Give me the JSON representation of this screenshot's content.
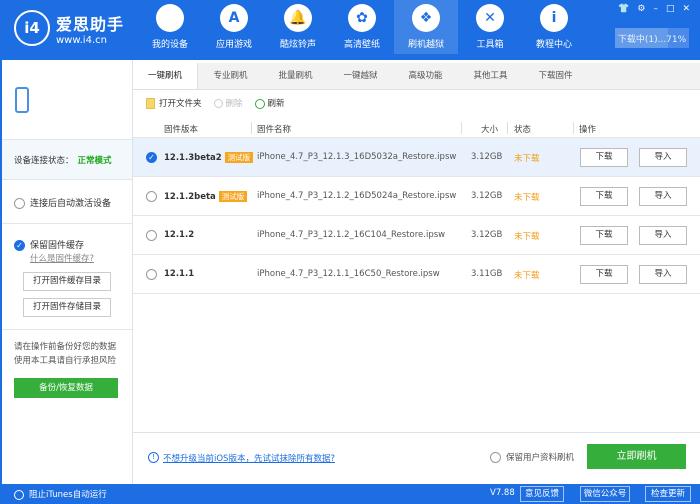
{
  "app": {
    "name": "爱思助手",
    "url": "www.i4.cn",
    "logo_text": "i4"
  },
  "nav": [
    {
      "label": "我的设备",
      "icon": "apple-icon",
      "glyph": ""
    },
    {
      "label": "应用游戏",
      "icon": "app-store-icon",
      "glyph": "A"
    },
    {
      "label": "酷炫铃声",
      "icon": "bell-icon",
      "glyph": "🔔"
    },
    {
      "label": "高清壁纸",
      "icon": "flower-icon",
      "glyph": "✿"
    },
    {
      "label": "刷机越狱",
      "icon": "box-icon",
      "glyph": "❖"
    },
    {
      "label": "工具箱",
      "icon": "tools-icon",
      "glyph": "✕"
    },
    {
      "label": "教程中心",
      "icon": "info-icon",
      "glyph": "i"
    }
  ],
  "nav_active": 4,
  "window_controls": {
    "skin": "👕",
    "settings": "⚙",
    "minimize": "–",
    "maximize": "□",
    "close": "✕"
  },
  "download": {
    "label": "下载中(1)...71%",
    "progress": 0.71
  },
  "sidebar": {
    "status_label": "设备连接状态：",
    "status_value": "正常模式",
    "auto_activate": "连接后自动激活设备",
    "keep_cache": "保留固件缓存",
    "what_cache": "什么是固件缓存?",
    "open_cache_dir": "打开固件缓存目录",
    "open_store_dir": "打开固件存储目录",
    "warning1": "请在操作前备份好您的数据",
    "warning2": "使用本工具请自行承担风险",
    "backup": "备份/恢复数据"
  },
  "tabs": [
    "一键刷机",
    "专业刷机",
    "批量刷机",
    "一键越狱",
    "高级功能",
    "其他工具",
    "下载固件"
  ],
  "toolbar": {
    "open_folder": "打开文件夹",
    "delete": "删除",
    "refresh": "刷新"
  },
  "columns": {
    "version": "固件版本",
    "name": "固件名称",
    "size": "大小",
    "state": "状态",
    "action": "操作"
  },
  "rows": [
    {
      "version": "12.1.3beta2",
      "tag": "测试版",
      "name": "iPhone_4.7_P3_12.1.3_16D5032a_Restore.ipsw",
      "size": "3.12GB",
      "state": "未下载",
      "download": "下载",
      "import": "导入",
      "selected": true
    },
    {
      "version": "12.1.2beta",
      "tag": "测试版",
      "name": "iPhone_4.7_P3_12.1.2_16D5024a_Restore.ipsw",
      "size": "3.12GB",
      "state": "未下载",
      "download": "下载",
      "import": "导入",
      "selected": false
    },
    {
      "version": "12.1.2",
      "tag": "",
      "name": "iPhone_4.7_P3_12.1.2_16C104_Restore.ipsw",
      "size": "3.12GB",
      "state": "未下载",
      "download": "下载",
      "import": "导入",
      "selected": false
    },
    {
      "version": "12.1.1",
      "tag": "",
      "name": "iPhone_4.7_P3_12.1.1_16C50_Restore.ipsw",
      "size": "3.11GB",
      "state": "未下载",
      "download": "下载",
      "import": "导入",
      "selected": false
    }
  ],
  "bottom": {
    "hint": "不想升级当前iOS版本，先试试抹除所有数据?",
    "keep_data": "保留用户资料刷机",
    "flash": "立即刷机"
  },
  "footer": {
    "itunes": "阻止iTunes自动运行",
    "version": "V7.88",
    "feedback": "意见反馈",
    "wechat": "微信公众号",
    "update": "检查更新"
  },
  "colors": {
    "brand": "#1d6ee2",
    "green": "#36ae3c",
    "warning": "#f39c12",
    "tag": "#f5a623"
  }
}
